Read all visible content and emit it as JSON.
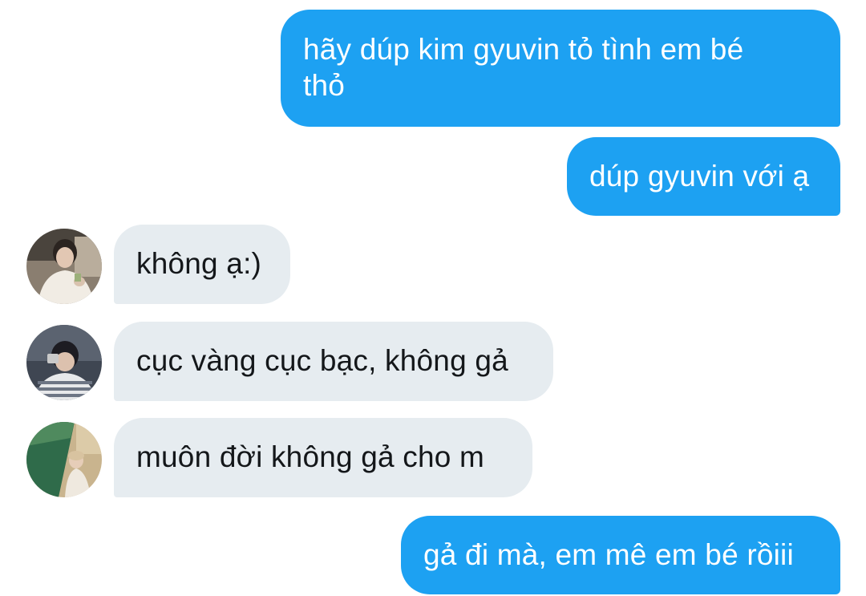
{
  "messages": [
    {
      "direction": "sent",
      "text": "hãy dúp kim gyuvin tỏ tình em bé\nthỏ"
    },
    {
      "direction": "sent",
      "text": "dúp gyuvin với ạ"
    },
    {
      "direction": "received",
      "text": "không ạ:)",
      "avatar": "avatar-photo-1"
    },
    {
      "direction": "received",
      "text": "cục vàng cục bạc, không gả",
      "avatar": "avatar-photo-2"
    },
    {
      "direction": "received",
      "text": "muôn đời không gả cho m",
      "avatar": "avatar-photo-3"
    },
    {
      "direction": "sent",
      "text": "gả đi mà, em mê em bé rồiii"
    }
  ],
  "colors": {
    "sent_bubble": "#1da1f2",
    "sent_text": "#ffffff",
    "received_bubble": "#e6ecf0",
    "received_text": "#14171a",
    "background": "#ffffff"
  }
}
